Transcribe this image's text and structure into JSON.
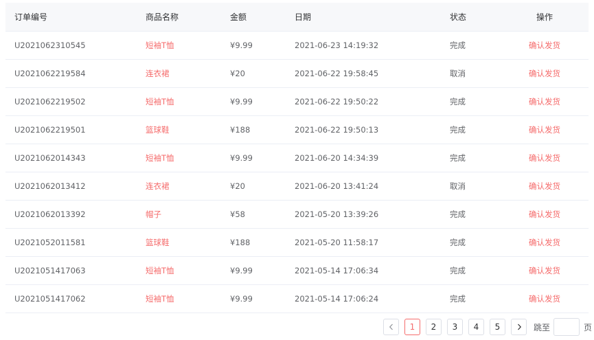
{
  "table": {
    "headers": {
      "order_id": "订单编号",
      "product": "商品名称",
      "amount": "金额",
      "date": "日期",
      "status": "状态",
      "action": "操作"
    },
    "rows": [
      {
        "order_id": "U2021062310545",
        "product": "短袖T恤",
        "amount": "¥9.99",
        "date": "2021-06-23 14:19:32",
        "status": "完成",
        "action": "确认发货"
      },
      {
        "order_id": "U2021062219584",
        "product": "连衣裙",
        "amount": "¥20",
        "date": "2021-06-22 19:58:45",
        "status": "取消",
        "action": "确认发货"
      },
      {
        "order_id": "U2021062219502",
        "product": "短袖T恤",
        "amount": "¥9.99",
        "date": "2021-06-22 19:50:22",
        "status": "完成",
        "action": "确认发货"
      },
      {
        "order_id": "U2021062219501",
        "product": "篮球鞋",
        "amount": "¥188",
        "date": "2021-06-22 19:50:13",
        "status": "完成",
        "action": "确认发货"
      },
      {
        "order_id": "U2021062014343",
        "product": "短袖T恤",
        "amount": "¥9.99",
        "date": "2021-06-20 14:34:39",
        "status": "完成",
        "action": "确认发货"
      },
      {
        "order_id": "U2021062013412",
        "product": "连衣裙",
        "amount": "¥20",
        "date": "2021-06-20 13:41:24",
        "status": "取消",
        "action": "确认发货"
      },
      {
        "order_id": "U2021062013392",
        "product": "帽子",
        "amount": "¥58",
        "date": "2021-05-20 13:39:26",
        "status": "完成",
        "action": "确认发货"
      },
      {
        "order_id": "U2021052011581",
        "product": "篮球鞋",
        "amount": "¥188",
        "date": "2021-05-20 11:58:17",
        "status": "完成",
        "action": "确认发货"
      },
      {
        "order_id": "U2021051417063",
        "product": "短袖T恤",
        "amount": "¥9.99",
        "date": "2021-05-14 17:06:34",
        "status": "完成",
        "action": "确认发货"
      },
      {
        "order_id": "U2021051417062",
        "product": "短袖T恤",
        "amount": "¥9.99",
        "date": "2021-05-14 17:06:24",
        "status": "完成",
        "action": "确认发货"
      }
    ]
  },
  "pagination": {
    "prev_icon": "chevron-left-icon",
    "next_icon": "chevron-right-icon",
    "pages": [
      "1",
      "2",
      "3",
      "4",
      "5"
    ],
    "current_page": "1",
    "jump_label": "跳至",
    "jump_value": "",
    "jump_suffix": "页"
  },
  "colors": {
    "accent": "#f56c6c",
    "header_bg": "#f7f8fa",
    "border": "#ebeef5",
    "text": "#606266"
  }
}
